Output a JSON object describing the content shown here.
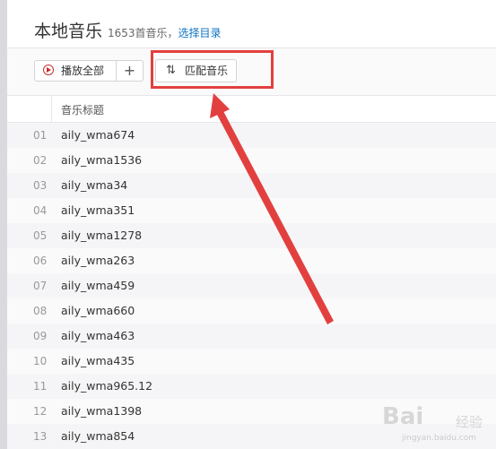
{
  "header": {
    "title": "本地音乐",
    "count_text": "1653首音乐，",
    "select_dir_link": "选择目录"
  },
  "toolbar": {
    "play_all_label": "播放全部",
    "add_label": "+",
    "match_label": "匹配音乐"
  },
  "table": {
    "column_title": "音乐标题",
    "rows": [
      {
        "num": "01",
        "name": "aily_wma674"
      },
      {
        "num": "02",
        "name": "aily_wma1536"
      },
      {
        "num": "03",
        "name": "aily_wma34"
      },
      {
        "num": "04",
        "name": "aily_wma351"
      },
      {
        "num": "05",
        "name": "aily_wma1278"
      },
      {
        "num": "06",
        "name": "aily_wma263"
      },
      {
        "num": "07",
        "name": "aily_wma459"
      },
      {
        "num": "08",
        "name": "aily_wma660"
      },
      {
        "num": "09",
        "name": "aily_wma463"
      },
      {
        "num": "10",
        "name": "aily_wma435"
      },
      {
        "num": "11",
        "name": "aily_wma965.12"
      },
      {
        "num": "12",
        "name": "aily_wma1398"
      },
      {
        "num": "13",
        "name": "aily_wma854"
      }
    ]
  },
  "watermark": {
    "text": "Bai",
    "sub": "经验",
    "url": "jingyan.baidu.com"
  },
  "colors": {
    "accent_red": "#c62f2f",
    "link_blue": "#0c73c2",
    "annotation_red": "#e2403f"
  }
}
